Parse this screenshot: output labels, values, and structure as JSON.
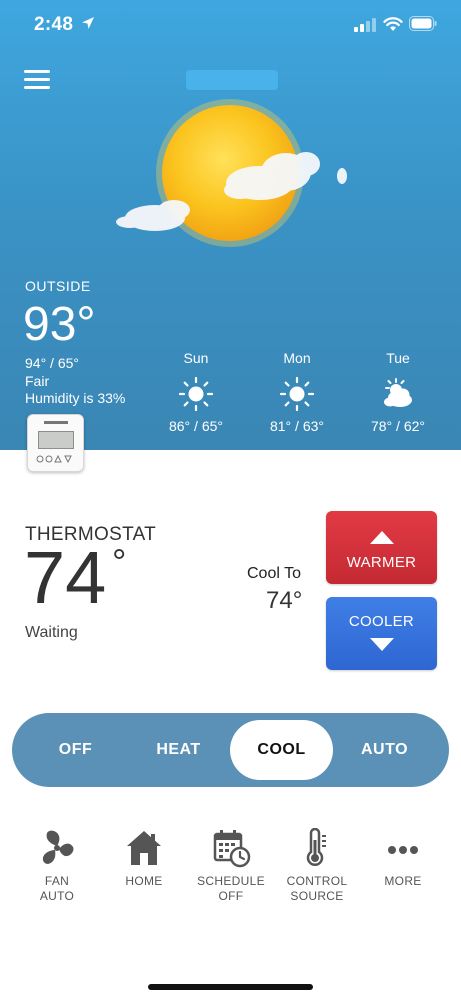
{
  "status_bar": {
    "time": "2:48"
  },
  "weather": {
    "outside_label": "OUTSIDE",
    "current_temp": "93°",
    "high_low": "94° / 65°",
    "condition": "Fair",
    "humidity": "Humidity is 33%",
    "forecast": [
      {
        "day": "Sun",
        "icon": "sun-icon",
        "temps": "86° / 65°"
      },
      {
        "day": "Mon",
        "icon": "sun-icon",
        "temps": "81° / 63°"
      },
      {
        "day": "Tue",
        "icon": "partly-cloudy-icon",
        "temps": "78° / 62°"
      }
    ]
  },
  "thermostat": {
    "label": "THERMOSTAT",
    "indoor_temp": "74",
    "degree": "°",
    "status": "Waiting",
    "setpoint_label": "Cool To",
    "setpoint_value": "74°",
    "warmer_label": "WARMER",
    "cooler_label": "COOLER"
  },
  "modes": {
    "options": [
      "OFF",
      "HEAT",
      "COOL",
      "AUTO"
    ],
    "selected": "COOL"
  },
  "nav": [
    {
      "icon": "fan-icon",
      "label_line1": "FAN",
      "label_line2": "AUTO"
    },
    {
      "icon": "home-icon",
      "label_line1": "HOME",
      "label_line2": ""
    },
    {
      "icon": "calendar-clock-icon",
      "label_line1": "SCHEDULE",
      "label_line2": "OFF"
    },
    {
      "icon": "thermometer-icon",
      "label_line1": "CONTROL",
      "label_line2": "SOURCE"
    },
    {
      "icon": "more-icon",
      "label_line1": "MORE",
      "label_line2": ""
    }
  ],
  "colors": {
    "sky_top": "#3fa7df",
    "sky_bottom": "#3a86b4",
    "warmer_red": "#d63340",
    "cooler_blue": "#3874dc",
    "mode_bar": "#5b91b6"
  }
}
